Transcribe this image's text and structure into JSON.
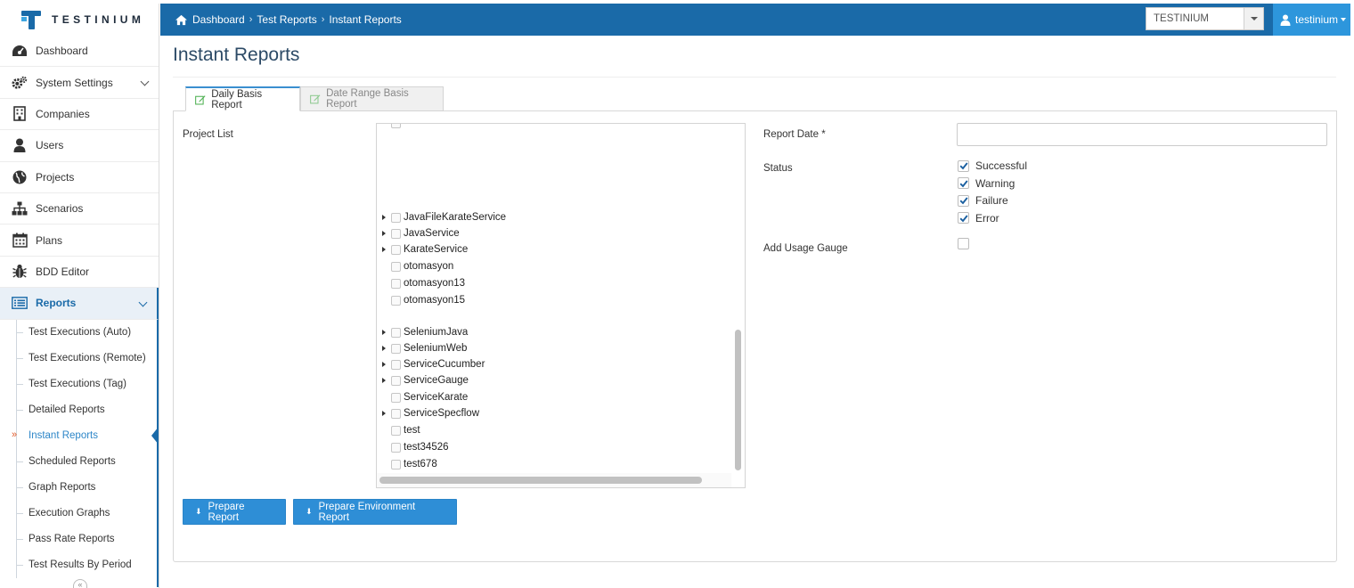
{
  "app": {
    "logo_text": "TESTINIUM"
  },
  "header": {
    "breadcrumbs": [
      "Dashboard",
      "Test Reports",
      "Instant Reports"
    ],
    "company_select": "TESTINIUM",
    "user_name": "testinium",
    "accent_color": "#1a6aa8",
    "user_menu_color": "#2d96dc"
  },
  "sidebar": {
    "items": [
      {
        "label": "Dashboard",
        "icon": "dashboard-icon"
      },
      {
        "label": "System Settings",
        "icon": "gears-icon"
      },
      {
        "label": "Companies",
        "icon": "building-icon"
      },
      {
        "label": "Users",
        "icon": "user-icon"
      },
      {
        "label": "Projects",
        "icon": "globe-icon"
      },
      {
        "label": "Scenarios",
        "icon": "sitemap-icon"
      },
      {
        "label": "Plans",
        "icon": "calendar-icon"
      },
      {
        "label": "BDD Editor",
        "icon": "bug-icon"
      },
      {
        "label": "Reports",
        "icon": "list-icon"
      }
    ],
    "reports_sub": [
      "Test Executions (Auto)",
      "Test Executions (Remote)",
      "Test Executions (Tag)",
      "Detailed Reports",
      "Instant Reports",
      "Scheduled Reports",
      "Graph Reports",
      "Execution Graphs",
      "Pass Rate Reports",
      "Test Results By Period"
    ],
    "current_marker": "»"
  },
  "main": {
    "title": "Instant Reports",
    "tabs": [
      "Daily Basis Report",
      "Date Range Basis Report"
    ],
    "project_list_label": "Project List",
    "report_date_label": "Report Date",
    "required_marker": "*",
    "report_date_value": "",
    "status_label": "Status",
    "statuses": [
      {
        "label": "Successful",
        "checked": true
      },
      {
        "label": "Warning",
        "checked": true
      },
      {
        "label": "Failure",
        "checked": true
      },
      {
        "label": "Error",
        "checked": true
      }
    ],
    "usage_gauge_label": "Add Usage Gauge",
    "usage_gauge_checked": false,
    "projects": [
      {
        "name": "JavaFileKarateService",
        "expandable": true
      },
      {
        "name": "JavaService",
        "expandable": true
      },
      {
        "name": "KarateService",
        "expandable": true
      },
      {
        "name": "otomasyon",
        "expandable": false
      },
      {
        "name": "otomasyon13",
        "expandable": false
      },
      {
        "name": "otomasyon15",
        "expandable": false
      },
      {
        "name": "SeleniumJava",
        "expandable": true
      },
      {
        "name": "SeleniumWeb",
        "expandable": true
      },
      {
        "name": "ServiceCucumber",
        "expandable": true
      },
      {
        "name": "ServiceGauge",
        "expandable": true
      },
      {
        "name": "ServiceKarate",
        "expandable": false
      },
      {
        "name": "ServiceSpecflow",
        "expandable": true
      },
      {
        "name": "test",
        "expandable": false
      },
      {
        "name": "test34526",
        "expandable": false
      },
      {
        "name": "test678",
        "expandable": false
      }
    ],
    "buttons": {
      "prepare_report": "Prepare Report",
      "prepare_env_report": "Prepare Environment Report",
      "download_glyph": "⬇"
    }
  }
}
